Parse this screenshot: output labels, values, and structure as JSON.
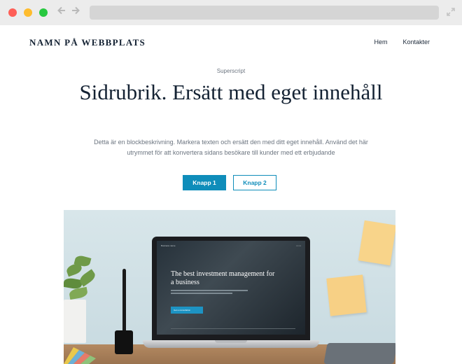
{
  "browser": {
    "back_icon": "arrow-left-icon",
    "forward_icon": "arrow-right-icon",
    "address": "",
    "colors": {
      "close": "#fe5f57",
      "minimize": "#febc2e",
      "maximize": "#28c840"
    }
  },
  "header": {
    "site_name": "NAMN PÅ WEBBPLATS",
    "menu": [
      {
        "label": "Hem"
      },
      {
        "label": "Kontakter"
      }
    ]
  },
  "hero": {
    "superscript": "Superscript",
    "headline": "Sidrubrik. Ersätt med eget innehåll",
    "description": "Detta är en blockbeskrivning. Markera texten och ersätt den med ditt eget innehåll. Använd det här utrymmet för att konvertera sidans besökare till kunder med ett erbjudande",
    "button1": "Knapp 1",
    "button2": "Knapp 2",
    "accent_color": "#0f8dba"
  },
  "hero_image": {
    "screen_brand": "Business name",
    "screen_title": "The best investment management for a business",
    "screen_button": "Get a consultation"
  }
}
